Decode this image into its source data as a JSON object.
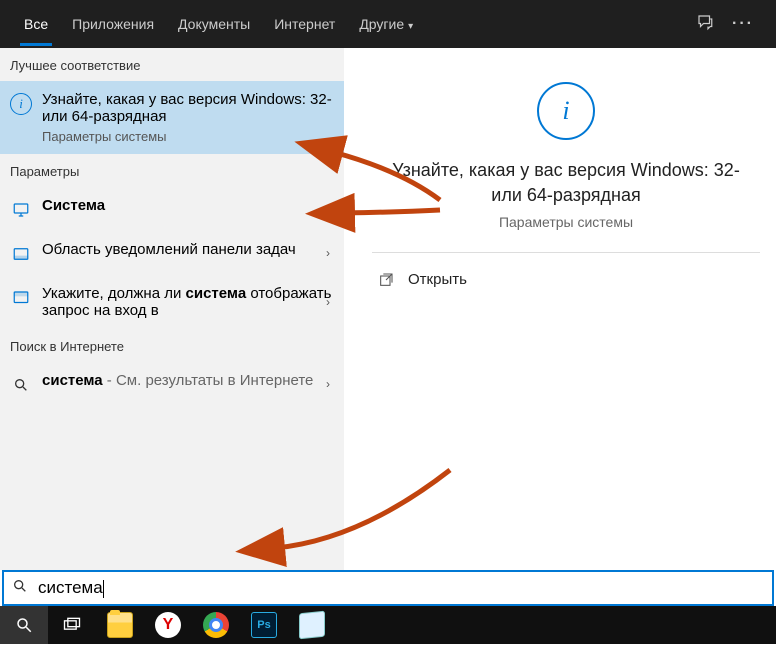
{
  "header": {
    "tabs": [
      {
        "label": "Все",
        "active": true
      },
      {
        "label": "Приложения",
        "active": false
      },
      {
        "label": "Документы",
        "active": false
      },
      {
        "label": "Интернет",
        "active": false
      },
      {
        "label": "Другие",
        "active": false,
        "hasDropdown": true
      }
    ]
  },
  "sections": {
    "best_match": "Лучшее соответствие",
    "settings": "Параметры",
    "web": "Поиск в Интернете"
  },
  "best_match_item": {
    "title": "Узнайте, какая у вас версия Windows: 32- или 64-разрядная",
    "subtitle": "Параметры системы"
  },
  "settings_items": [
    {
      "prefix": "",
      "bold": "Система",
      "suffix": "",
      "icon": "monitor"
    },
    {
      "prefix": "Область уведомлений панели задач",
      "bold": "",
      "suffix": "",
      "icon": "taskbar"
    },
    {
      "prefix": "Укажите, должна ли ",
      "bold": "система",
      "suffix": " отображать запрос на вход в",
      "icon": "lockscreen"
    }
  ],
  "web_item": {
    "bold": "система",
    "suffix": " - См. результаты в Интернете"
  },
  "right_pane": {
    "title": "Узнайте, какая у вас версия Windows: 32- или 64-разрядная",
    "subtitle": "Параметры системы",
    "open_label": "Открыть"
  },
  "search": {
    "value": "система"
  },
  "colors": {
    "accent": "#0078d4",
    "arrow": "#c1440e"
  }
}
